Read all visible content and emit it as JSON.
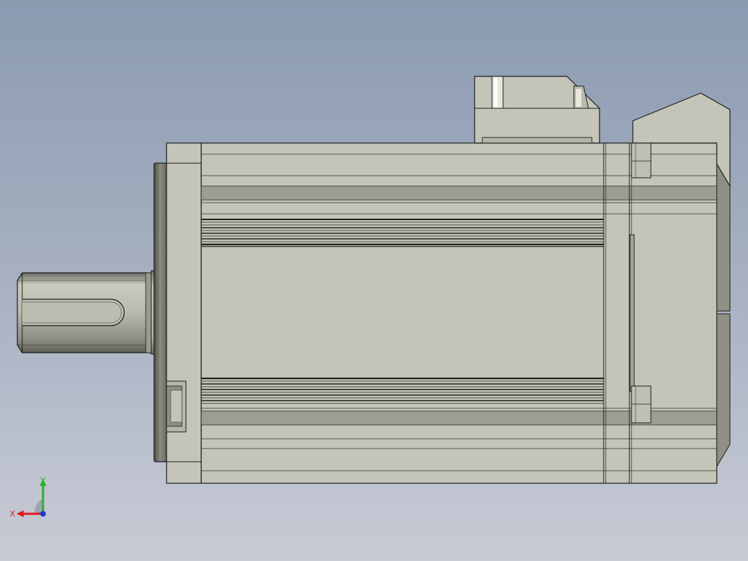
{
  "viewport": {
    "background_top": "#8b9ab0",
    "background_bottom": "#c8cbd5"
  },
  "model": {
    "body_color": "#c4c4b8",
    "edge_color": "#1a1a1a",
    "shadow_color": "#7c7c72"
  },
  "triad": {
    "x_label": "X",
    "y_label": "Y",
    "x_color": "#e0191c",
    "y_color": "#25b02a",
    "z_color": "#2233cc"
  }
}
